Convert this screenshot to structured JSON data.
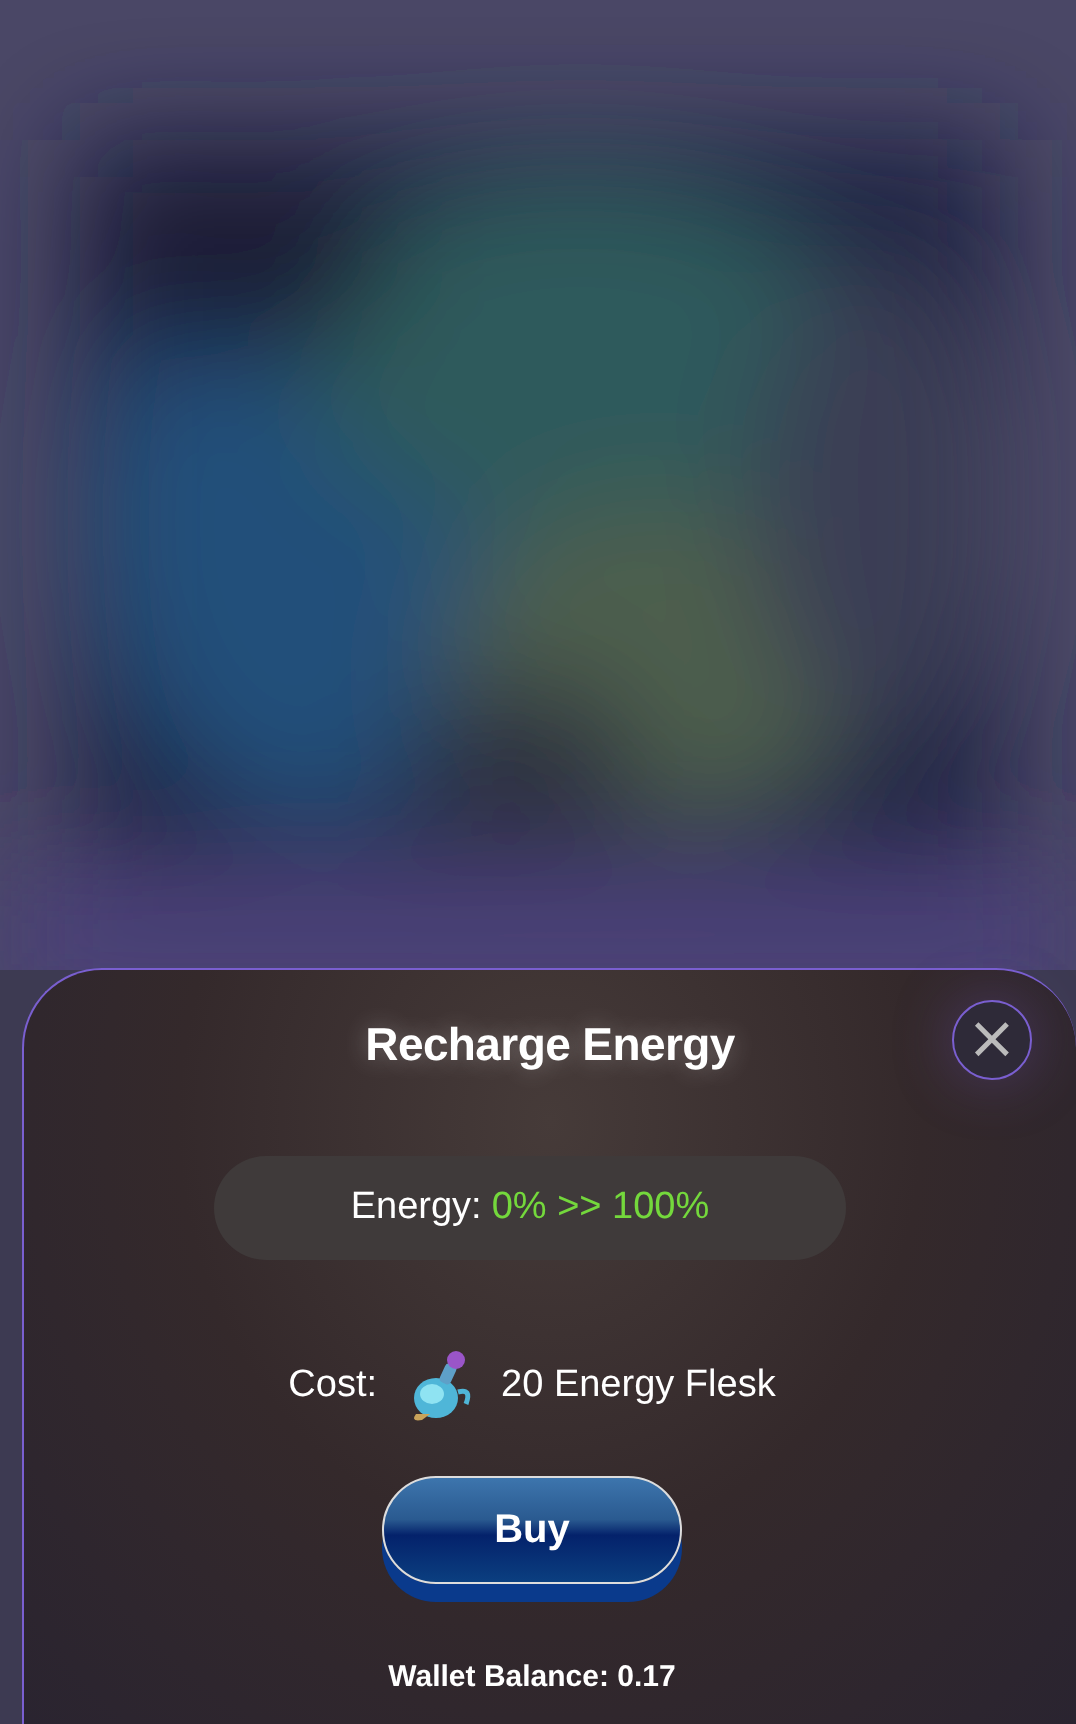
{
  "dialog": {
    "title": "Recharge Energy",
    "close": "×",
    "energy": {
      "label": "Energy:",
      "value": "0% >> 100%"
    },
    "cost": {
      "label": "Cost:",
      "amount": "20 Energy Flesk"
    },
    "buy_button": "Buy",
    "wallet_balance": "Wallet Balance: 0.17"
  }
}
